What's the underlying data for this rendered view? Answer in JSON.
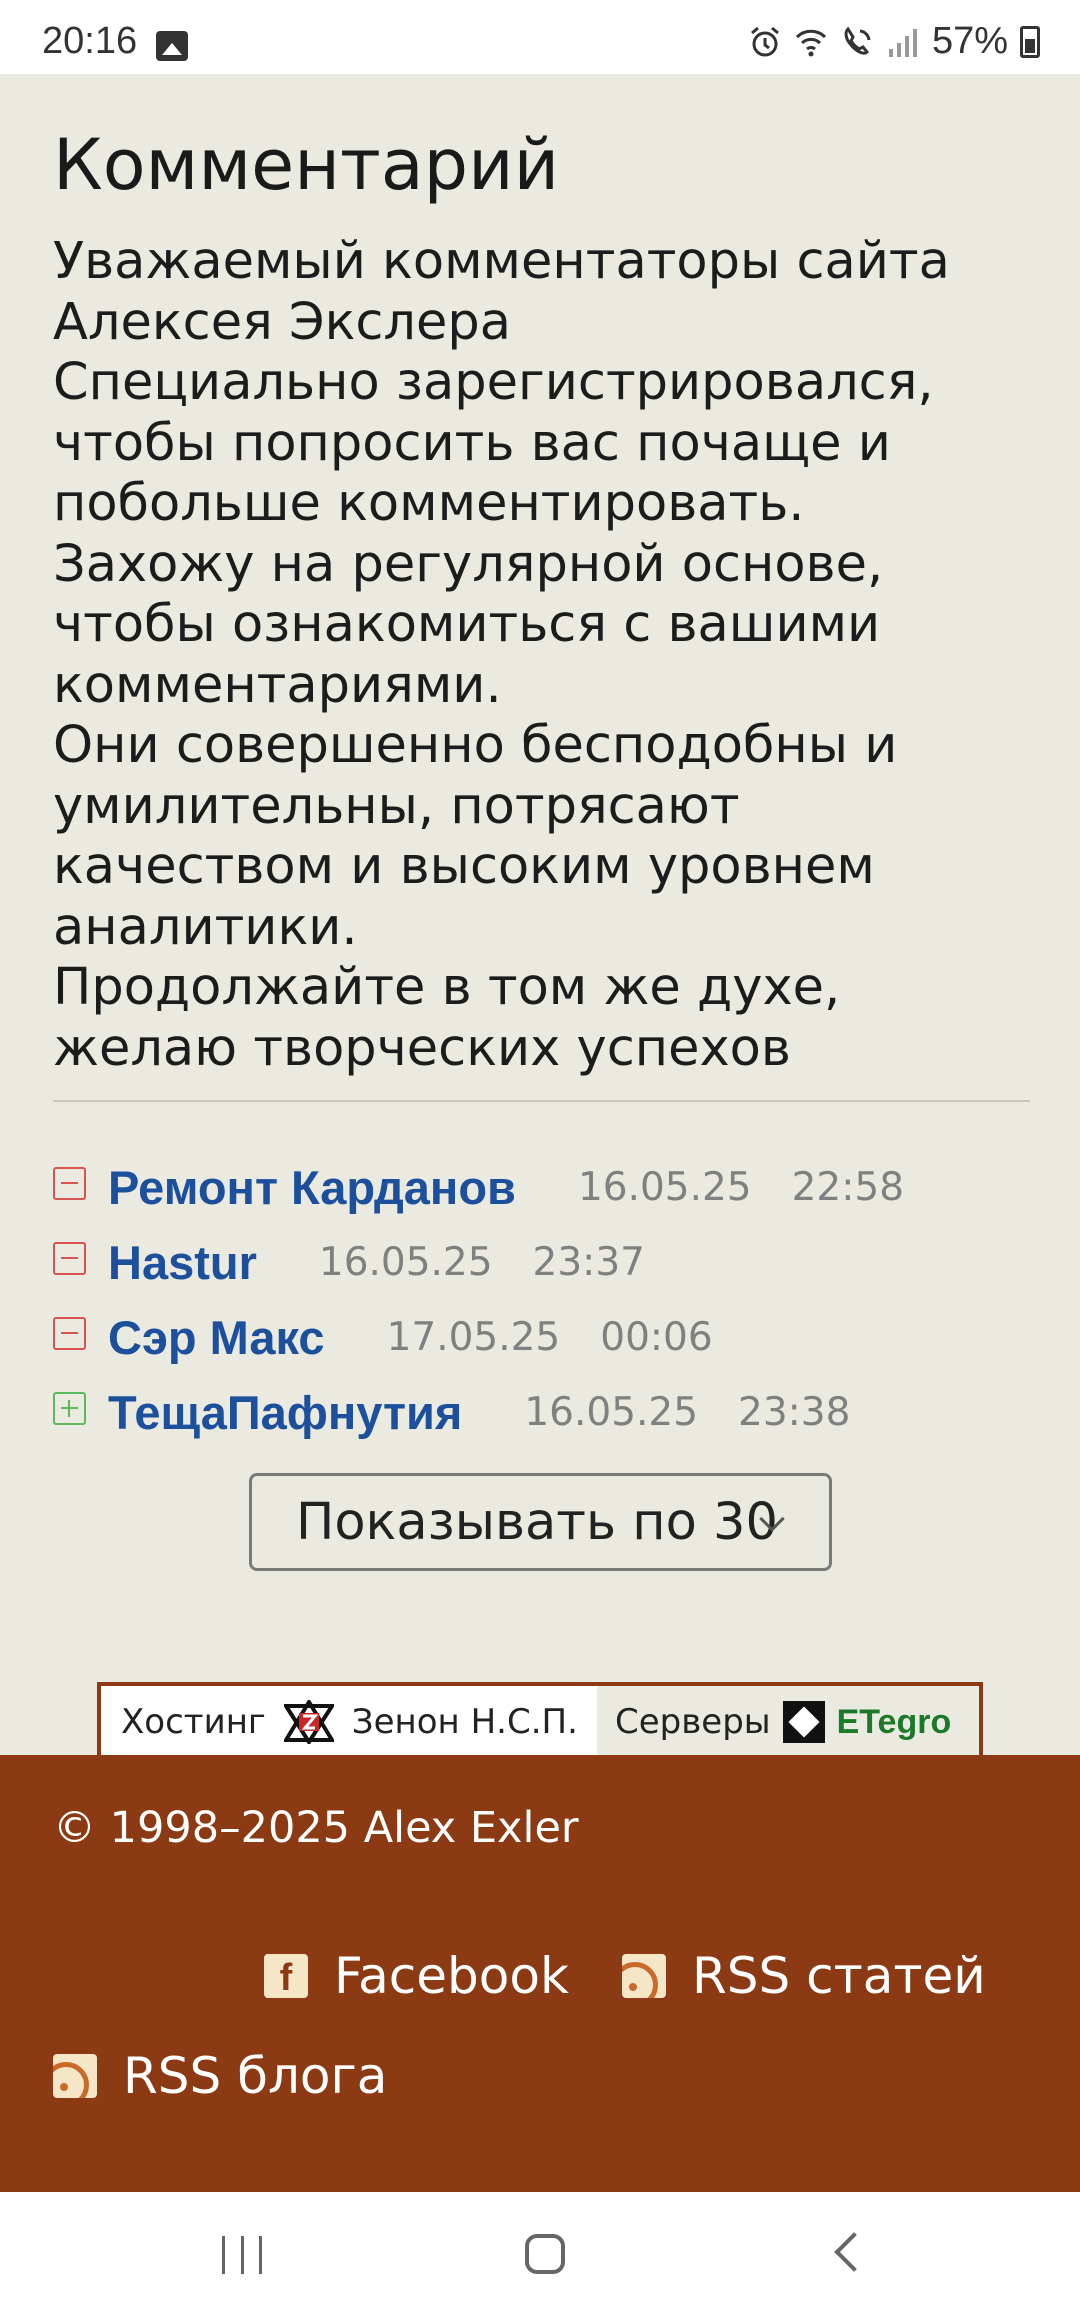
{
  "status_bar": {
    "time": "20:16",
    "battery": "57%",
    "icons": [
      "gallery-icon",
      "alarm-icon",
      "wifi-icon",
      "wifi-call-icon",
      "signal-icon",
      "battery-icon"
    ]
  },
  "page": {
    "title": "Комментарий",
    "paragraphs": [
      "Уважаемый комментаторы сайта Алексея Экслера",
      "Специально зарегистрировался, чтобы попросить вас почаще и побольше комментировать.",
      "Захожу на регулярной основе, чтобы ознакомиться с вашими комментариями.",
      "Они совершенно бесподобны и умилительны, потрясают качеством и высоким уровнем аналитики.",
      "Продолжайте в том же духе, желаю творческих успехов"
    ]
  },
  "thread": [
    {
      "author": "Ремонт Карданов",
      "date": "16.05.25",
      "time": "22:58",
      "toggle": "collapse"
    },
    {
      "author": "Hastur",
      "date": "16.05.25",
      "time": "23:37",
      "toggle": "collapse"
    },
    {
      "author": "Сэр Макс",
      "date": "17.05.25",
      "time": "00:06",
      "toggle": "collapse"
    },
    {
      "author": "ТещаПафнутия",
      "date": "16.05.25",
      "time": "23:38",
      "toggle": "expand"
    }
  ],
  "pager": {
    "selected": "Показывать по 30"
  },
  "hosting": {
    "hosting_label": "Хостинг",
    "hosting_name": "Зенон Н.С.П.",
    "servers_label": "Серверы",
    "servers_brand": "ETegro"
  },
  "footer": {
    "copyright": "© 1998–2025 Alex Exler",
    "facebook": "Facebook",
    "rss_articles": "RSS статей",
    "rss_blog": "RSS блога"
  },
  "colors": {
    "background": "#ebeae0",
    "link": "#1c4f9c",
    "footer": "#8b3a14",
    "collapse": "#d9534f",
    "expand": "#5cb85c"
  }
}
